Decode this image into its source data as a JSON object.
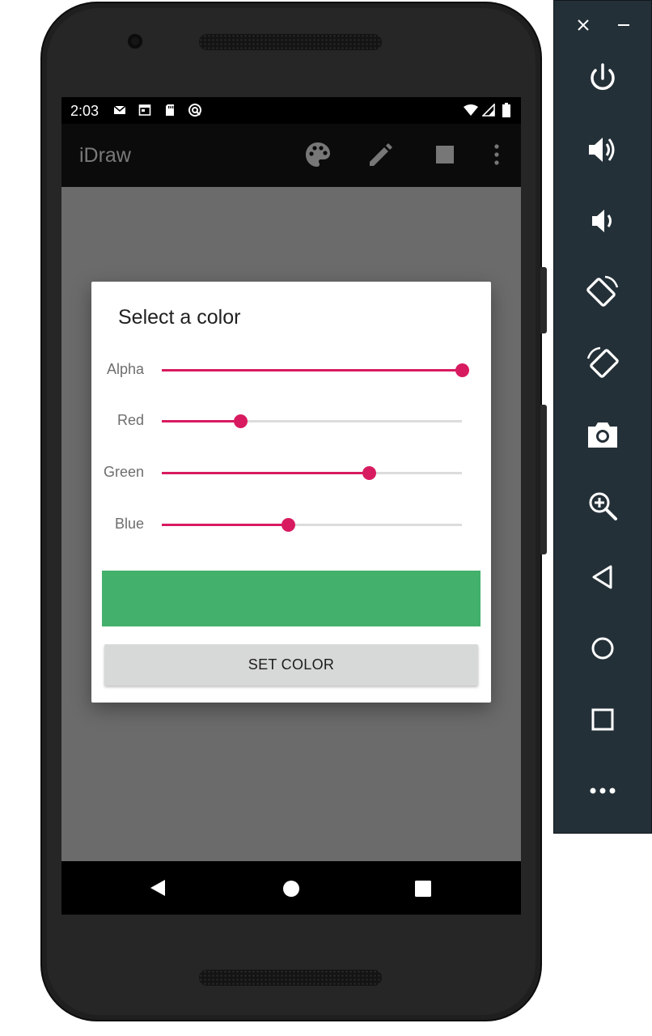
{
  "device": {
    "status_time": "2:03",
    "status_icons_left": [
      "gmail-icon",
      "calendar-icon",
      "sd-card-icon",
      "sync-icon"
    ],
    "status_icons_right": [
      "wifi-icon",
      "signal-icon",
      "battery-icon"
    ]
  },
  "app": {
    "title": "iDraw",
    "toolbar": [
      "palette-icon",
      "pencil-icon",
      "stop-square-icon",
      "overflow-menu-icon"
    ]
  },
  "dialog": {
    "title": "Select a color",
    "sliders": [
      {
        "label": "Alpha",
        "value": 255,
        "max": 255
      },
      {
        "label": "Red",
        "value": 67,
        "max": 255
      },
      {
        "label": "Green",
        "value": 176,
        "max": 255
      },
      {
        "label": "Blue",
        "value": 107,
        "max": 255
      }
    ],
    "preview_color": "#43b06b",
    "button_label": "SET COLOR"
  },
  "colors": {
    "accent": "#d81b60",
    "track": "#dcdcdc",
    "appbar": "#0b0b0b",
    "canvas": "#6b6b6b",
    "emulator_panel": "#243038"
  },
  "navbar": [
    "back-icon",
    "home-icon",
    "recents-icon"
  ],
  "emulator_panel": {
    "window_controls": [
      "close-icon",
      "minimize-icon"
    ],
    "buttons": [
      "power-icon",
      "volume-up-icon",
      "volume-down-icon",
      "rotate-left-icon",
      "rotate-right-icon",
      "camera-icon",
      "zoom-icon",
      "back-icon",
      "home-icon",
      "overview-icon",
      "more-icon"
    ]
  }
}
